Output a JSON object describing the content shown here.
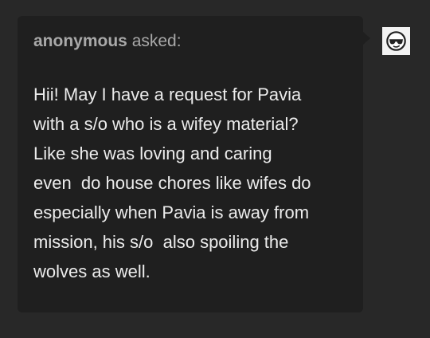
{
  "ask": {
    "asker_name": "anonymous",
    "asked_label": "asked:",
    "question_lines": [
      "Hii! May I have a request for Pavia",
      "with a s/o who is a wifey material?",
      "Like she was loving and caring",
      "even  do house chores like wifes do",
      "especially when Pavia is away from",
      "mission, his s/o  also spoiling the",
      "wolves as well."
    ]
  },
  "avatar": {
    "icon": "anonymous-sunglasses-face-icon"
  },
  "colors": {
    "page_background": "#282828",
    "card_background": "#1f1f1f",
    "asker_text": "#a9a9a9",
    "question_text": "#ececec",
    "avatar_background": "#f2f2f2"
  }
}
